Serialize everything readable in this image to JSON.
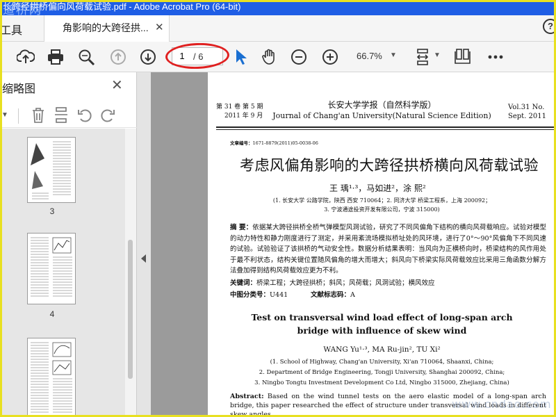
{
  "window": {
    "title": "长跨径拱桥偏向风荷载试验.pdf - Adobe Acrobat Pro (64-bit)"
  },
  "watermark_top": "道桥网",
  "watermark_bottom": "www.cndao.com",
  "tabs": {
    "tools_label": "工具",
    "doc_tab_label": "角影响的大跨径拱..."
  },
  "toolbar": {
    "page_current": "1",
    "page_total": "/ 6",
    "zoom": "66.7%"
  },
  "sidebar": {
    "title": "缩略图",
    "thumb_labels": [
      "3",
      "4"
    ]
  },
  "page": {
    "vol_cn_1": "第 31 卷   第 5 期",
    "vol_cn_2": "2011 年 9 月",
    "journal_cn": "长安大学学报（自然科学版）",
    "journal_en": "Journal of Chang'an University(Natural Science Edition)",
    "vol_en_1": "Vol.31   No.",
    "vol_en_2": "Sept.  2011",
    "article_no_label": "文章编号：",
    "article_no": "1671-8879(2011)05-0038-06",
    "title_cn": "考虑风偏角影响的大跨径拱桥横向风荷载试验",
    "authors_cn": "王   瑀¹·³，马如进²，涂   熙²",
    "aff_cn_1": "(1. 长安大学 公路学院，陕西 西安 710064；2. 同济大学 桥梁工程系，上海 200092；",
    "aff_cn_2": "3. 宁波通途投资开发有限公司，宁波 315000)",
    "abstract_cn_label": "摘   要：",
    "abstract_cn": "依据某大跨径拱桥全桥气弹模型风洞试验，研究了不同风偏角下结构的横向风荷载响应。试验对模型的动力特性和静力刚度进行了测定，并采用紊流场模拟桥址处的风环境，进行了0°～90°风偏角下不同风速的试验。试验验证了该拱桥的气动安全性。数据分析结果表明：当风向为正横桥向时，桥梁结构的风作用处于最不利状态，结构关键位置随风偏角的增大而增大；斜风向下桥梁实际风荷载效应比采用三角函数分解方法叠加得到结构风荷载效应更为不利。",
    "keywords_label": "关键词：",
    "keywords": "桥梁工程；大跨径拱桥；斜风；风荷载；风洞试验；横风效应",
    "cls_label": "中图分类号：",
    "cls": "U441",
    "doc_code_label": "文献标志码：",
    "doc_code": "A",
    "title_en_1": "Test on transversal wind load effect of long-span arch",
    "title_en_2": "bridge with influence of skew wind",
    "authors_en": "WANG Yu¹·³, MA Ru-jin², TU Xi²",
    "aff_en_1": "(1. School of Highway, Chang'an University, Xi'an 710064, Shaanxi, China;",
    "aff_en_2": "2. Department of Bridge Engineering, Tongji University, Shanghai 200092, China;",
    "aff_en_3": "3. Ningbo Tongtu Investment Development Co Ltd, Ningbo 315000, Zhejiang, China)",
    "abstract_en_label": "Abstract:",
    "abstract_en": "Based on the wind tunnel tests on the aero elastic model of a long-span arch bridge, this paper researched the effect of structure under transversal wind loads in different skew angles."
  }
}
